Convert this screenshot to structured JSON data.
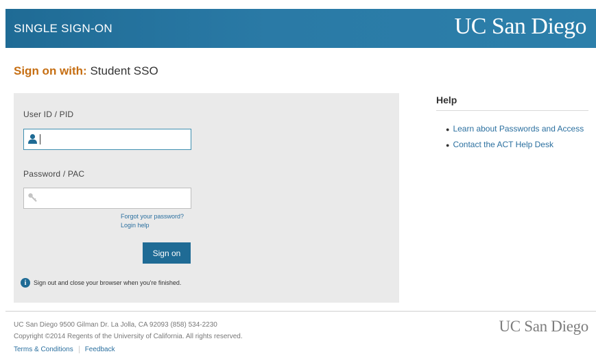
{
  "header": {
    "title": "SINGLE SIGN-ON",
    "logo_text": "UC San Diego"
  },
  "signon": {
    "lead": "Sign on with:",
    "value": "Student SSO"
  },
  "form": {
    "user_label": "User ID / PID",
    "user_value": "",
    "user_icon": "user-icon",
    "password_label": "Password / PAC",
    "password_value": "",
    "password_icon": "key-icon",
    "forgot_link": "Forgot your password?",
    "login_help_link": "Login help",
    "submit_label": "Sign on",
    "notice": "Sign out and close your browser when you're finished."
  },
  "help": {
    "title": "Help",
    "links": [
      "Learn about Passwords and Access",
      "Contact the ACT Help Desk"
    ]
  },
  "footer": {
    "address": "UC San Diego 9500 Gilman Dr. La Jolla, CA 92093 (858) 534-2230",
    "copyright": "Copyright ©2014 Regents of the University of California. All rights reserved.",
    "links": [
      "Terms & Conditions",
      "Feedback"
    ],
    "logo_text": "UC San Diego"
  },
  "colors": {
    "brand_blue": "#1f6b95",
    "accent_orange": "#c66e12",
    "link_blue": "#2a6f9f",
    "panel_gray": "#eaeaea"
  }
}
